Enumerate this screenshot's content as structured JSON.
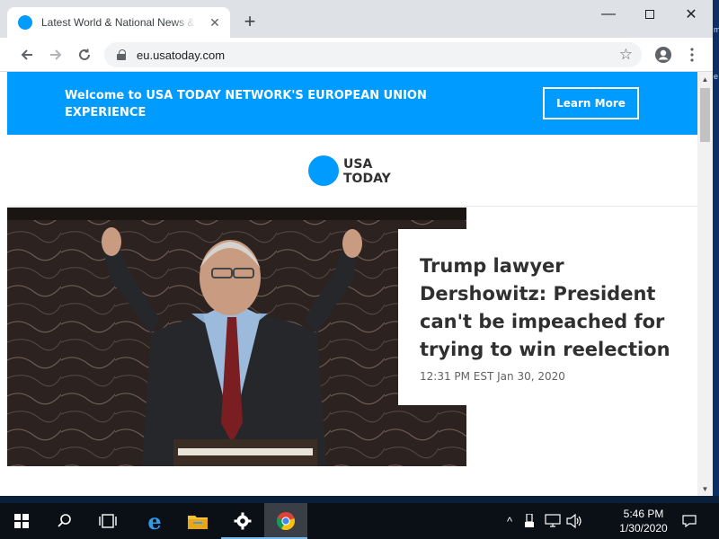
{
  "browser": {
    "tab_title": "Latest World & National News & Headlines",
    "url": "eu.usatoday.com"
  },
  "page": {
    "banner_text": "Welcome to USA TODAY NETWORK'S EUROPEAN UNION EXPERIENCE",
    "learn_more": "Learn More",
    "logo_line1": "USA",
    "logo_line2": "TODAY",
    "headline": "Trump lawyer Dershowitz: President can't be impeached for trying to win reelection",
    "timestamp": "12:31 PM EST Jan 30, 2020"
  },
  "taskbar": {
    "time": "5:46 PM",
    "date": "1/30/2020"
  },
  "colors": {
    "brand_blue": "#009bff",
    "taskbar_bg": "#0b0f16"
  },
  "icons": [
    "usatoday-favicon",
    "close-icon",
    "plus-icon",
    "minimize-icon",
    "maximize-icon",
    "back-arrow-icon",
    "forward-arrow-icon",
    "reload-icon",
    "lock-icon",
    "star-icon",
    "profile-icon",
    "kebab-menu-icon",
    "windows-start-icon",
    "search-icon",
    "task-view-icon",
    "ie-icon",
    "file-explorer-icon",
    "settings-gear-icon",
    "chrome-icon",
    "chevron-up-icon",
    "usb-icon",
    "network-icon",
    "volume-icon",
    "notification-icon"
  ]
}
